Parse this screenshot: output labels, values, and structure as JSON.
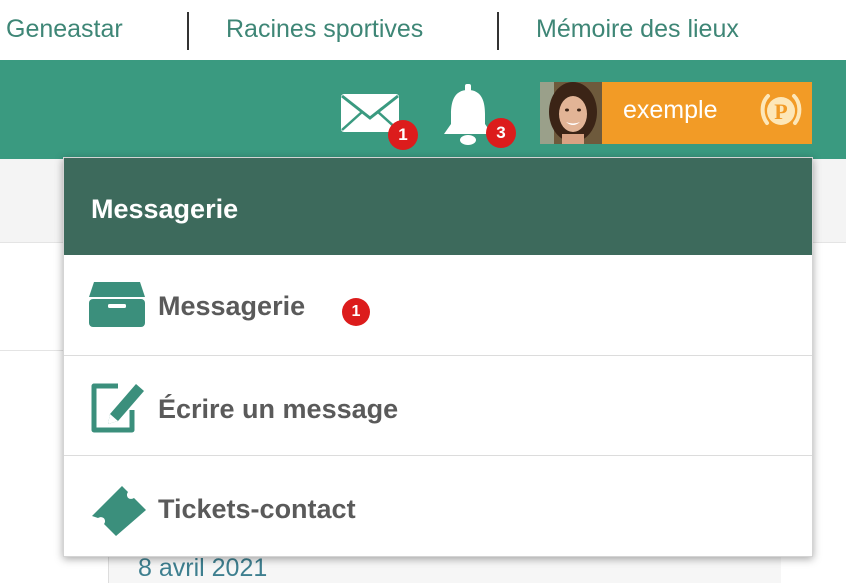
{
  "top_links": [
    {
      "label": "Geneastar"
    },
    {
      "label": "Racines sportives"
    },
    {
      "label": "Mémoire des lieux"
    }
  ],
  "header": {
    "messages_badge": "1",
    "notifications_badge": "3",
    "user": {
      "name": "exemple",
      "premium_letter": "P"
    }
  },
  "dropdown": {
    "title": "Messagerie",
    "items": [
      {
        "label": "Messagerie",
        "badge": "1",
        "icon": "inbox-tray-icon"
      },
      {
        "label": "Écrire un message",
        "icon": "compose-icon"
      },
      {
        "label": "Tickets-contact",
        "icon": "ticket-icon"
      }
    ]
  },
  "page": {
    "date": "8 avril 2021"
  },
  "colors": {
    "header_green": "#3a9a80",
    "dropdown_header": "#3d6a5c",
    "icon_teal": "#3b8f7c",
    "link_teal": "#3e8676",
    "user_orange": "#f29b26",
    "badge_red": "#dc1c1c"
  }
}
